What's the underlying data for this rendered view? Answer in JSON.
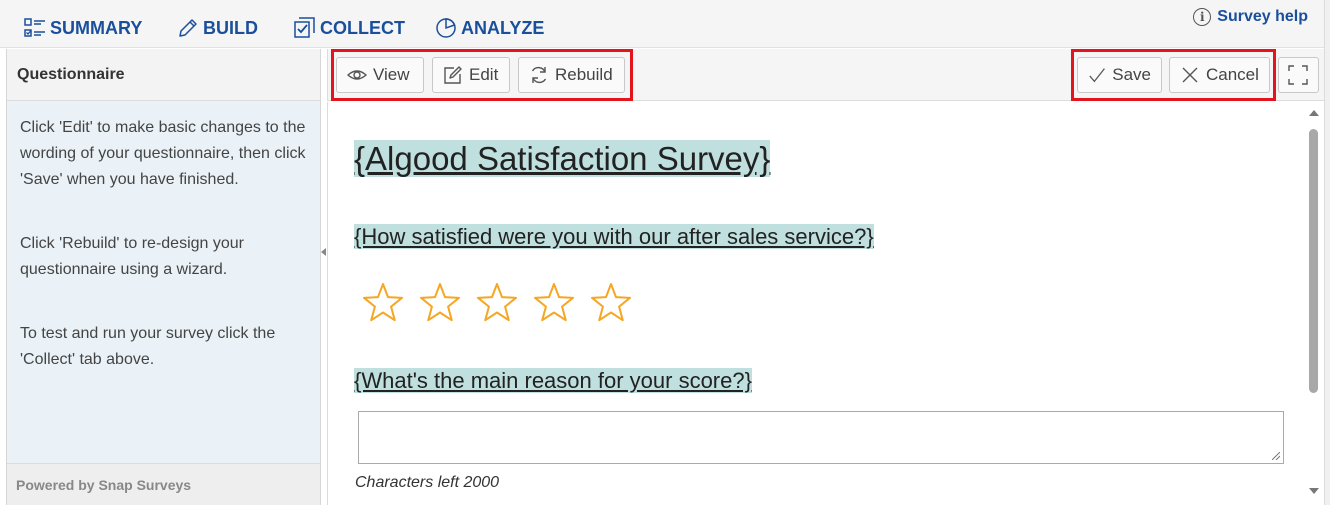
{
  "nav": {
    "tabs": [
      {
        "label": "SUMMARY",
        "icon": "summary-list-icon"
      },
      {
        "label": "BUILD",
        "icon": "pencil-icon"
      },
      {
        "label": "COLLECT",
        "icon": "collect-checkbox-icon"
      },
      {
        "label": "ANALYZE",
        "icon": "pie-chart-icon"
      }
    ],
    "help_label": "Survey help",
    "help_icon": "info-icon"
  },
  "sidebar": {
    "title": "Questionnaire",
    "paragraphs": [
      "Click 'Edit' to make basic changes to the wording of your questionnaire, then click 'Save' when you have finished.",
      "Click 'Rebuild' to re-design your questionnaire using a wizard.",
      "To test and run your survey click the 'Collect' tab above."
    ],
    "footer": "Powered by Snap Surveys"
  },
  "toolbar": {
    "view_label": "View",
    "edit_label": "Edit",
    "rebuild_label": "Rebuild",
    "save_label": "Save",
    "cancel_label": "Cancel"
  },
  "survey": {
    "title": "{Algood Satisfaction Survey}",
    "question1": "{How satisfied were you with our after sales service?}",
    "rating_max": 5,
    "rating_value": 0,
    "question2": "{What's the main reason for your score?}",
    "answer_value": "",
    "chars_left": "Characters left 2000"
  },
  "colors": {
    "nav_text": "#1a4f9c",
    "highlight": "#bfe0df",
    "star": "#f5a623",
    "annotation_box": "#e3141c"
  }
}
